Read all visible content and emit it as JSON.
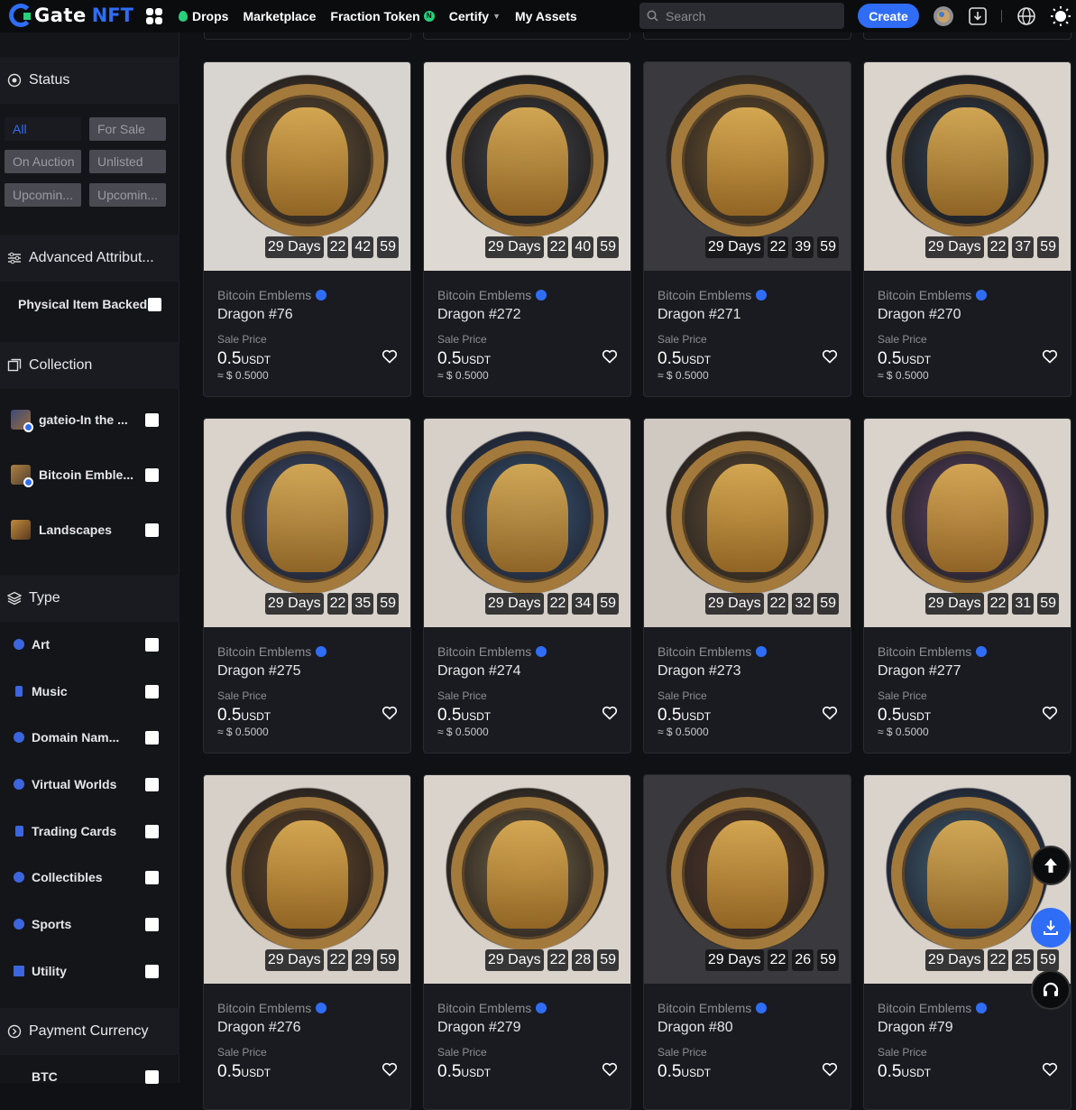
{
  "header": {
    "brand": "Gate",
    "brand_suffix": "NFT",
    "nav": [
      {
        "label": "Drops"
      },
      {
        "label": "Marketplace"
      },
      {
        "label": "Fraction Token"
      },
      {
        "label": "Certify"
      },
      {
        "label": "My Assets"
      }
    ],
    "search_placeholder": "Search",
    "create_label": "Create"
  },
  "sidebar": {
    "status_title": "Status",
    "status_options": [
      "All",
      "For Sale",
      "On Auction",
      "Unlisted",
      "Upcomin...",
      "Upcomin..."
    ],
    "advanced_title": "Advanced Attribut...",
    "physical_label": "Physical Item Backed",
    "collection_title": "Collection",
    "collections": [
      "gateio-In the ...",
      "Bitcoin Emble...",
      "Landscapes"
    ],
    "type_title": "Type",
    "types": [
      "Art",
      "Music",
      "Domain Nam...",
      "Virtual Worlds",
      "Trading Cards",
      "Collectibles",
      "Sports",
      "Utility"
    ],
    "payment_title": "Payment Currency",
    "payment_options": [
      "BTC"
    ]
  },
  "cards": [
    {
      "collection": "Bitcoin Emblems",
      "name": "Dragon #76",
      "sale_label": "Sale Price",
      "price": "0.5",
      "unit": "USDT",
      "usd": "≈ $ 0.5000",
      "t": [
        "29 Days",
        "22",
        "42",
        "59"
      ]
    },
    {
      "collection": "Bitcoin Emblems",
      "name": "Dragon #272",
      "sale_label": "Sale Price",
      "price": "0.5",
      "unit": "USDT",
      "usd": "≈ $ 0.5000",
      "t": [
        "29 Days",
        "22",
        "40",
        "59"
      ]
    },
    {
      "collection": "Bitcoin Emblems",
      "name": "Dragon #271",
      "sale_label": "Sale Price",
      "price": "0.5",
      "unit": "USDT",
      "usd": "≈ $ 0.5000",
      "t": [
        "29 Days",
        "22",
        "39",
        "59"
      ]
    },
    {
      "collection": "Bitcoin Emblems",
      "name": "Dragon #270",
      "sale_label": "Sale Price",
      "price": "0.5",
      "unit": "USDT",
      "usd": "≈ $ 0.5000",
      "t": [
        "29 Days",
        "22",
        "37",
        "59"
      ]
    },
    {
      "collection": "Bitcoin Emblems",
      "name": "Dragon #275",
      "sale_label": "Sale Price",
      "price": "0.5",
      "unit": "USDT",
      "usd": "≈ $ 0.5000",
      "t": [
        "29 Days",
        "22",
        "35",
        "59"
      ]
    },
    {
      "collection": "Bitcoin Emblems",
      "name": "Dragon #274",
      "sale_label": "Sale Price",
      "price": "0.5",
      "unit": "USDT",
      "usd": "≈ $ 0.5000",
      "t": [
        "29 Days",
        "22",
        "34",
        "59"
      ]
    },
    {
      "collection": "Bitcoin Emblems",
      "name": "Dragon #273",
      "sale_label": "Sale Price",
      "price": "0.5",
      "unit": "USDT",
      "usd": "≈ $ 0.5000",
      "t": [
        "29 Days",
        "22",
        "32",
        "59"
      ]
    },
    {
      "collection": "Bitcoin Emblems",
      "name": "Dragon #277",
      "sale_label": "Sale Price",
      "price": "0.5",
      "unit": "USDT",
      "usd": "≈ $ 0.5000",
      "t": [
        "29 Days",
        "22",
        "31",
        "59"
      ]
    },
    {
      "collection": "Bitcoin Emblems",
      "name": "Dragon #276",
      "sale_label": "Sale Price",
      "price": "0.5",
      "unit": "USDT",
      "usd": "",
      "t": [
        "29 Days",
        "22",
        "29",
        "59"
      ]
    },
    {
      "collection": "Bitcoin Emblems",
      "name": "Dragon #279",
      "sale_label": "Sale Price",
      "price": "0.5",
      "unit": "USDT",
      "usd": "",
      "t": [
        "29 Days",
        "22",
        "28",
        "59"
      ]
    },
    {
      "collection": "Bitcoin Emblems",
      "name": "Dragon #80",
      "sale_label": "Sale Price",
      "price": "0.5",
      "unit": "USDT",
      "usd": "",
      "t": [
        "29 Days",
        "22",
        "26",
        "59"
      ]
    },
    {
      "collection": "Bitcoin Emblems",
      "name": "Dragon #79",
      "sale_label": "Sale Price",
      "price": "0.5",
      "unit": "USDT",
      "usd": "",
      "t": [
        "29 Days",
        "22",
        "25",
        "59"
      ]
    }
  ],
  "colors": {
    "accent": "#2f6df6",
    "green": "#26d07c",
    "bg": "#101114",
    "card": "#1a1b20"
  }
}
